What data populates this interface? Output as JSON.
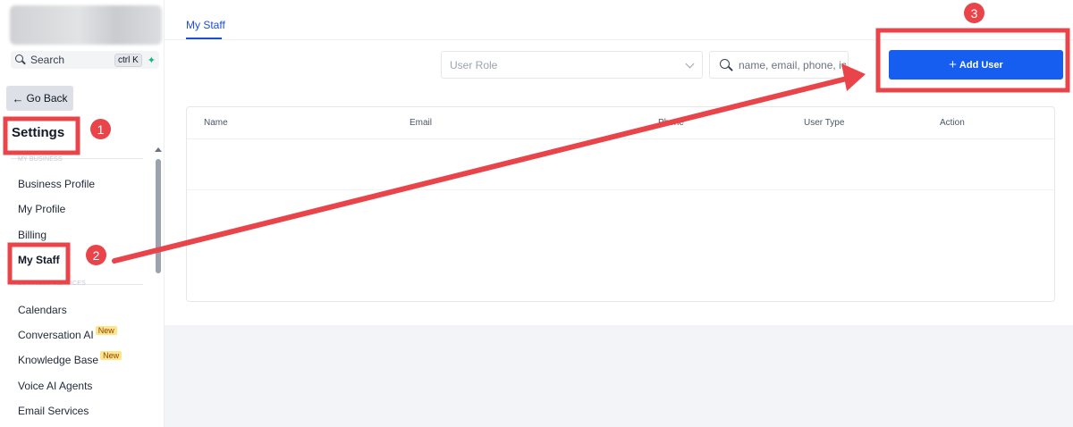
{
  "sidebar": {
    "search": {
      "label": "Search",
      "shortcut": "ctrl K"
    },
    "go_back": "Go Back",
    "title": "Settings",
    "section_my_business": "MY BUSINESS",
    "section_business_services": "BUSINESS SERVICES",
    "items": [
      {
        "label": "Business Profile"
      },
      {
        "label": "My Profile"
      },
      {
        "label": "Billing"
      },
      {
        "label": "My Staff"
      },
      {
        "label": "Calendars"
      },
      {
        "label": "Conversation AI",
        "badge": "New"
      },
      {
        "label": "Knowledge Base",
        "badge": "New"
      },
      {
        "label": "Voice AI Agents"
      },
      {
        "label": "Email Services"
      }
    ]
  },
  "main": {
    "tab": "My Staff",
    "role_select": {
      "placeholder": "User Role"
    },
    "search_input": {
      "placeholder": "name, email, phone, ic"
    },
    "add_button": "Add User",
    "table": {
      "columns": [
        "Name",
        "Email",
        "Phone",
        "User Type",
        "Action"
      ]
    }
  },
  "annotations": {
    "callouts": [
      "1",
      "2",
      "3"
    ],
    "color": "#e8444a"
  },
  "colors": {
    "accent": "#155eef",
    "tab_active": "#1d4ed8",
    "badge_bg": "#fde68a",
    "annotation": "#e8444a"
  }
}
